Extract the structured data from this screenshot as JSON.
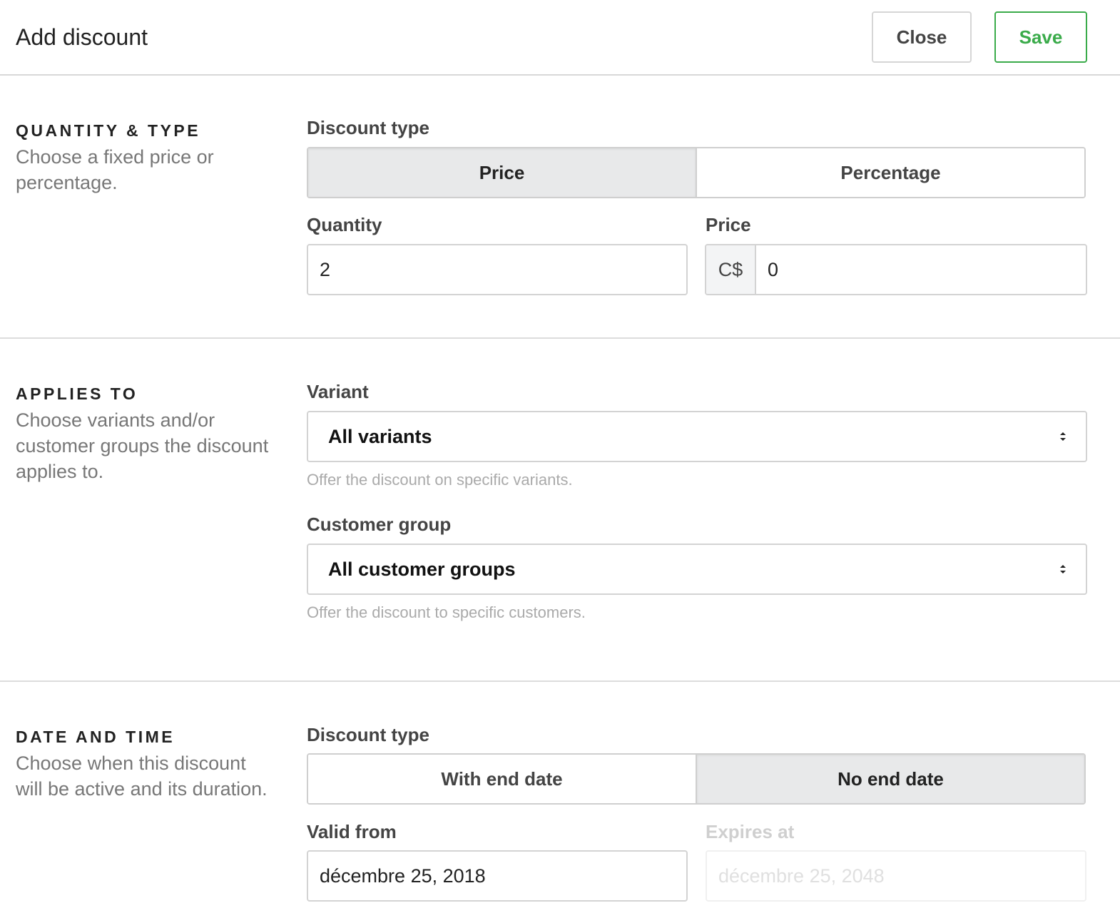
{
  "header": {
    "title": "Add discount",
    "close_label": "Close",
    "save_label": "Save",
    "save_color": "#3aab4a"
  },
  "quantity_type": {
    "title": "QUANTITY & TYPE",
    "description": "Choose a fixed price or percentage.",
    "discount_type_label": "Discount type",
    "options": [
      "Price",
      "Percentage"
    ],
    "selected": "Price",
    "quantity_label": "Quantity",
    "quantity_value": "2",
    "price_label": "Price",
    "currency": "C$",
    "price_value": "0"
  },
  "applies_to": {
    "title": "APPLIES TO",
    "description": "Choose variants and/or customer groups the discount applies to.",
    "variant_label": "Variant",
    "variant_value": "All variants",
    "variant_help": "Offer the discount on specific variants.",
    "customer_group_label": "Customer group",
    "customer_group_value": "All customer groups",
    "customer_group_help": "Offer the discount to specific customers."
  },
  "date_time": {
    "title": "DATE AND TIME",
    "description": "Choose when this discount will be active and its duration.",
    "discount_type_label": "Discount type",
    "options": [
      "With end date",
      "No end date"
    ],
    "selected": "No end date",
    "valid_from_label": "Valid from",
    "valid_from_value": "décembre 25, 2018",
    "expires_at_label": "Expires at",
    "expires_at_value": "décembre 25, 2048"
  },
  "icons": {
    "select_arrow": "select-arrows-icon"
  }
}
